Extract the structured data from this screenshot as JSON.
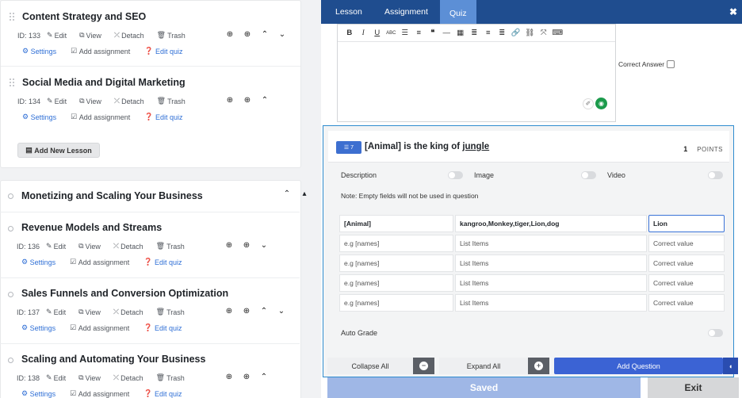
{
  "curriculum": {
    "lessons": [
      {
        "title": "Content Strategy and SEO",
        "id": "ID: 133"
      },
      {
        "title": "Social Media and Digital Marketing",
        "id": "ID: 134"
      },
      {
        "title": "Revenue Models and Streams",
        "id": "ID: 136"
      },
      {
        "title": "Sales Funnels and Conversion Optimization",
        "id": "ID: 137"
      },
      {
        "title": "Scaling and Automating Your Business",
        "id": "ID: 138"
      }
    ],
    "actions": {
      "edit": "Edit",
      "view": "View",
      "detach": "Detach",
      "trash": "Trash"
    },
    "links": {
      "settings": "Settings",
      "add_assignment": "Add assignment",
      "edit_quiz": "Edit quiz"
    },
    "add_lesson": "Add New Lesson",
    "section_title": "Monetizing and Scaling Your Business"
  },
  "modal": {
    "tabs": [
      "Lesson",
      "Assignment",
      "Quiz"
    ],
    "active_tab": "Quiz",
    "correct_answer_label": "Correct Answer",
    "question": {
      "badge": "7",
      "title_prefix": "[Animal] is the king of ",
      "title_underlined": "jungle",
      "points_value": "1",
      "points_label": "POINTS",
      "options": [
        "Description",
        "Image",
        "Video"
      ],
      "note": "Note: Empty fields will not be used in question",
      "rows": [
        {
          "name": "[Animal]",
          "items": "kangroo,Monkey,tiger,Lion,dog",
          "correct": "Lion"
        },
        {
          "name": "e.g [names]",
          "items": "List Items",
          "correct": "Correct value"
        },
        {
          "name": "e.g [names]",
          "items": "List Items",
          "correct": "Correct value"
        },
        {
          "name": "e.g [names]",
          "items": "List Items",
          "correct": "Correct value"
        },
        {
          "name": "e.g [names]",
          "items": "List Items",
          "correct": "Correct value"
        }
      ],
      "auto_grade": "Auto Grade"
    },
    "buttons": {
      "collapse": "Collapse All",
      "expand": "Expand All",
      "add_question": "Add Question"
    },
    "footer": {
      "saved": "Saved",
      "exit": "Exit"
    }
  },
  "colors": {
    "tabbar": "#1f4d8f",
    "active_tab": "#5c8fd6",
    "accent": "#3b63d4",
    "frame": "#2f8ccf"
  }
}
